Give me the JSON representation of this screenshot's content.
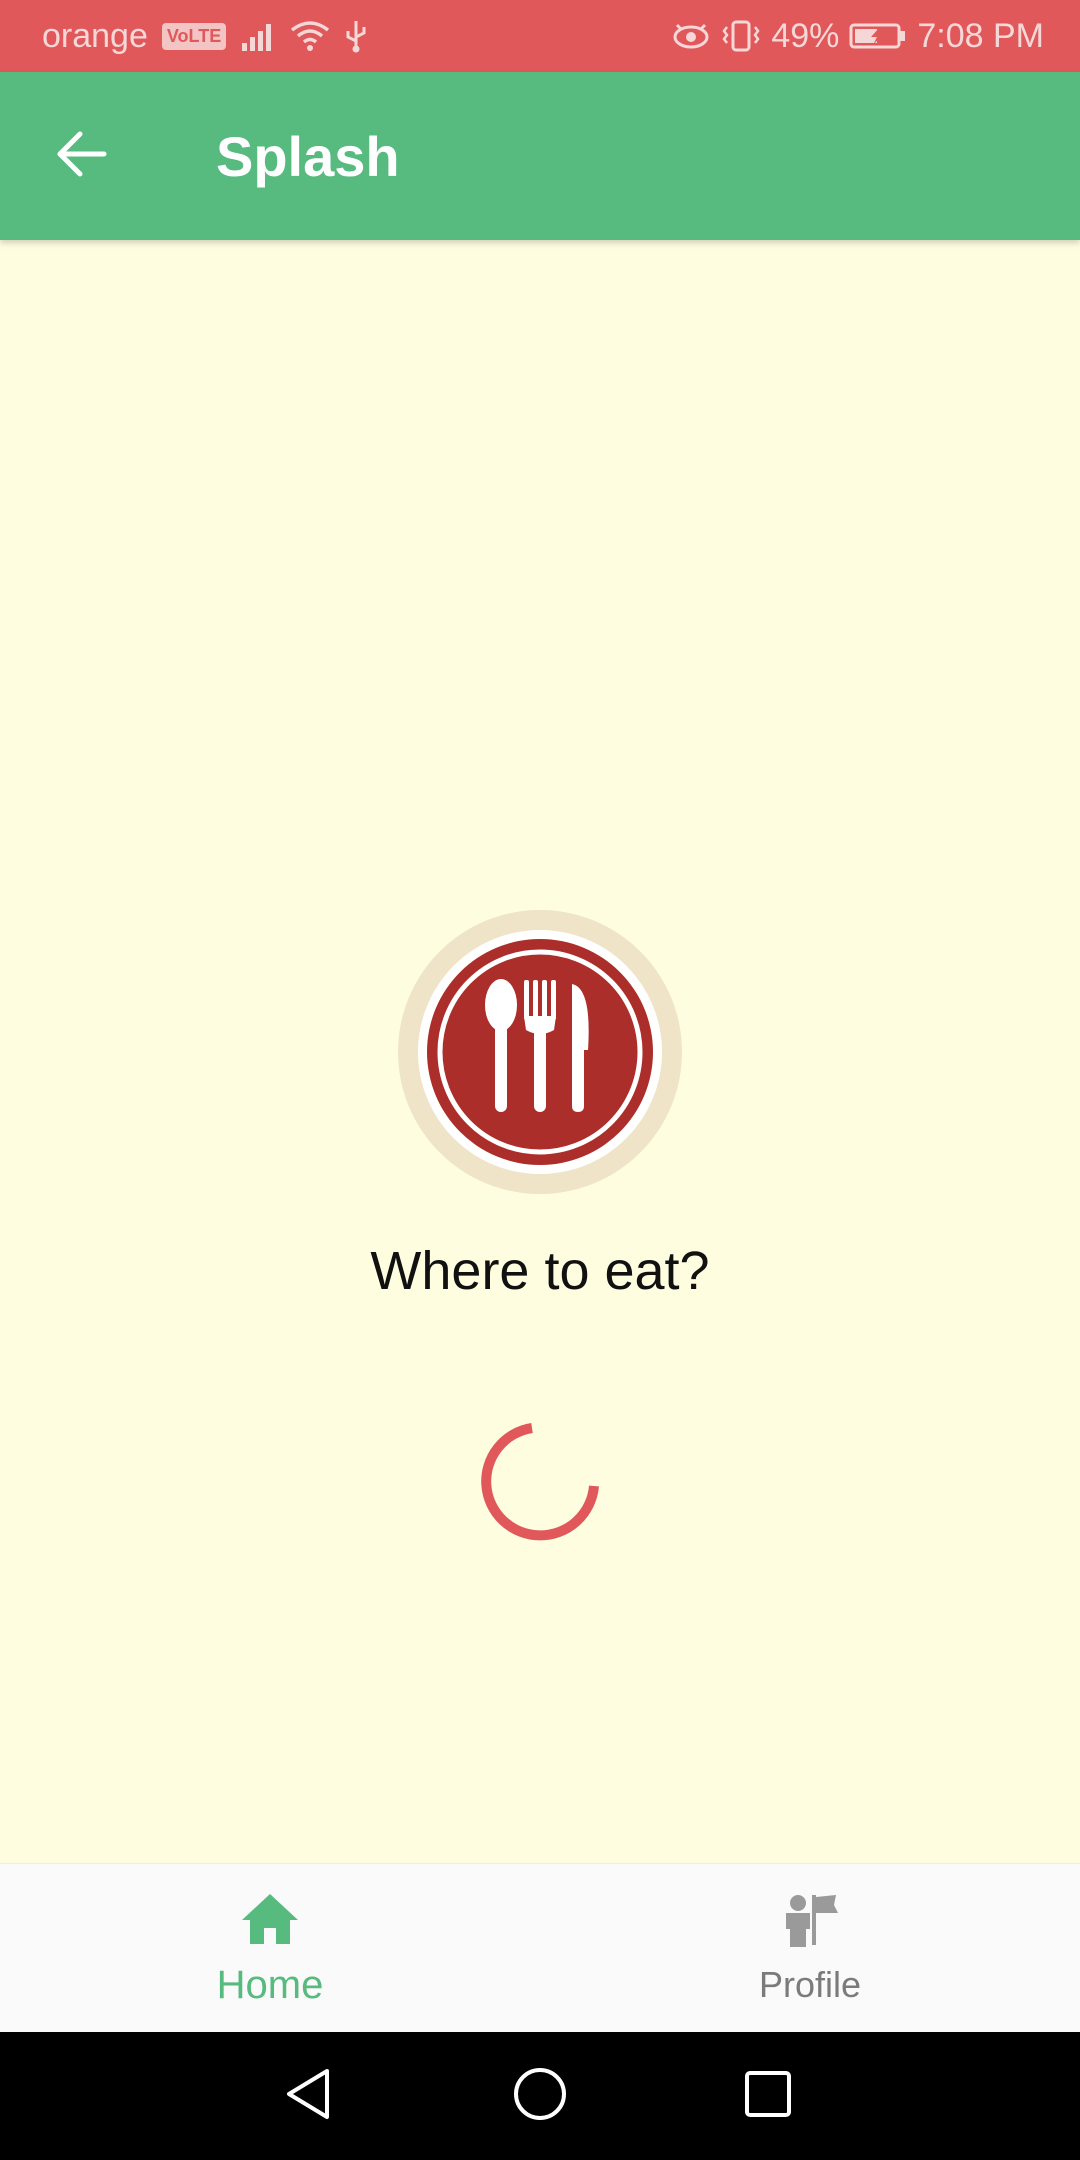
{
  "status_bar": {
    "carrier": "orange",
    "volte": "VoLTE",
    "battery": "49%",
    "time": "7:08 PM",
    "icons": [
      "signal-icon",
      "wifi-icon",
      "usb-icon",
      "eye-icon",
      "vibrate-icon",
      "battery-charging-icon"
    ]
  },
  "app_bar": {
    "title": "Splash",
    "back_icon": "arrow-back-icon"
  },
  "content": {
    "tagline": "Where to eat?",
    "logo_icon": "restaurant-cutlery-icon",
    "spinner": "loading-spinner"
  },
  "bottom_nav": {
    "items": [
      {
        "label": "Home",
        "icon": "home-icon",
        "active": true
      },
      {
        "label": "Profile",
        "icon": "profile-icon",
        "active": false
      }
    ]
  },
  "system_nav": {
    "buttons": [
      "back-triangle-icon",
      "home-circle-icon",
      "recents-square-icon"
    ]
  },
  "colors": {
    "status_bar": "#e0585a",
    "app_bar": "#57bb80",
    "background": "#fefde0",
    "accent_red": "#ab2e2a",
    "spinner": "#e0585a",
    "nav_active": "#57bb80",
    "nav_inactive": "#7b7b7b"
  }
}
